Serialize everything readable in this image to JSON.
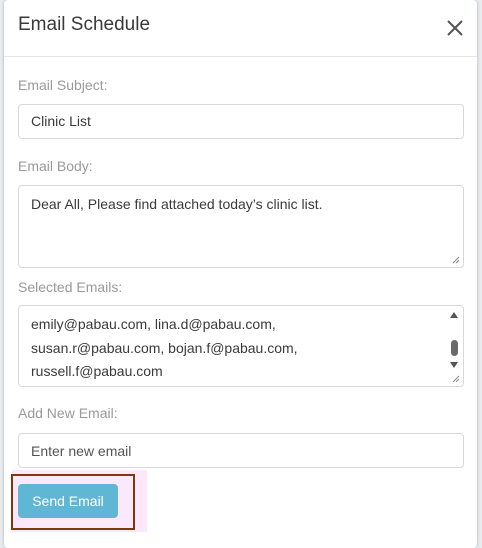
{
  "modal": {
    "title": "Email Schedule",
    "close_icon": "close-icon"
  },
  "subject": {
    "label": "Email Subject:",
    "value": "Clinic List"
  },
  "body": {
    "label": "Email Body:",
    "value": "Dear All, Please find attached today’s clinic list."
  },
  "selected_emails": {
    "label": "Selected Emails:",
    "lines": [
      "emily@pabau.com, lina.d@pabau.com,",
      "susan.r@pabau.com, bojan.f@pabau.com,",
      "russell.f@pabau.com"
    ]
  },
  "new_email": {
    "label": "Add New Email:",
    "placeholder": "Enter new email"
  },
  "send": {
    "label": "Send Email"
  },
  "colors": {
    "accent": "#5fb7d5",
    "highlight_outline": "#7a3b10",
    "highlight_bg": "#fbe8fb"
  }
}
